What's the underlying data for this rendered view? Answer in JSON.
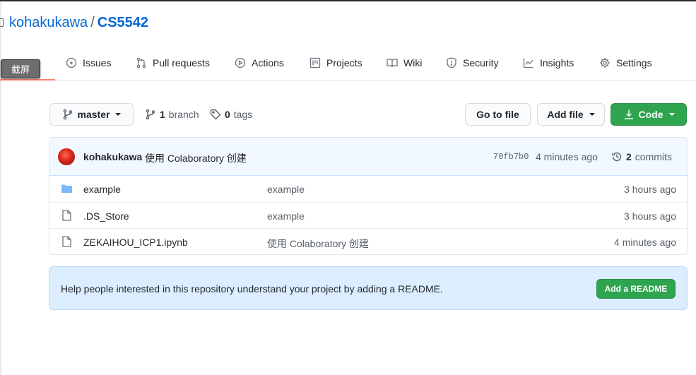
{
  "repo": {
    "owner": "kohakukawa",
    "separator": "/",
    "name": "CS5542"
  },
  "tooltip": "截屏",
  "code_tab_partial": "e",
  "tabs": [
    {
      "label": "Issues",
      "icon": "issue-opened-icon"
    },
    {
      "label": "Pull requests",
      "icon": "git-pull-request-icon"
    },
    {
      "label": "Actions",
      "icon": "play-icon"
    },
    {
      "label": "Projects",
      "icon": "project-icon"
    },
    {
      "label": "Wiki",
      "icon": "book-icon"
    },
    {
      "label": "Security",
      "icon": "shield-icon"
    },
    {
      "label": "Insights",
      "icon": "graph-icon"
    },
    {
      "label": "Settings",
      "icon": "gear-icon"
    }
  ],
  "toolbar": {
    "branch_label": "master",
    "branch_count": "1",
    "branch_word": "branch",
    "tag_count": "0",
    "tag_word": "tags",
    "go_to_file": "Go to file",
    "add_file": "Add file",
    "code": "Code"
  },
  "commit": {
    "author": "kohakukawa",
    "message": "使用 Colaboratory 创建",
    "sha": "70fb7b0",
    "time": "4 minutes ago",
    "count": "2",
    "count_word": "commits"
  },
  "files": [
    {
      "type": "folder",
      "name": "example",
      "message": "example",
      "time": "3 hours ago"
    },
    {
      "type": "file",
      "name": ".DS_Store",
      "message": "example",
      "time": "3 hours ago"
    },
    {
      "type": "file",
      "name": "ZEKAIHOU_ICP1.ipynb",
      "message": "使用 Colaboratory 创建",
      "time": "4 minutes ago"
    }
  ],
  "readme": {
    "text": "Help people interested in this repository understand your project by adding a README.",
    "button": "Add a README"
  },
  "colors": {
    "link": "#0366d6",
    "green": "#2ea44f",
    "tab_underline": "#f9826c",
    "readme_bg": "#dbedff"
  }
}
